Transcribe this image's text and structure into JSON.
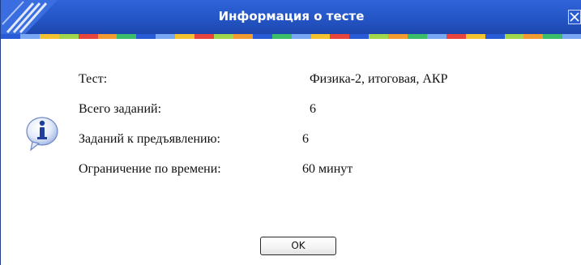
{
  "dialog": {
    "title": "Информация о тесте",
    "colors": {
      "titlebar": "#2557c8",
      "stripe": [
        "#2a5bd6",
        "#7aa7f2",
        "#f2c230",
        "#9fd64a",
        "#e8453c",
        "#f29b30",
        "#3bbd6a",
        "#2a5bd6",
        "#7aa7f2",
        "#f2c230",
        "#e8453c",
        "#9fd64a",
        "#f29b30",
        "#2a5bd6",
        "#3bbd6a",
        "#7aa7f2",
        "#f2c230",
        "#e8453c",
        "#2a5bd6",
        "#9fd64a",
        "#f29b30",
        "#3bbd6a",
        "#7aa7f2",
        "#e8453c",
        "#f2c230",
        "#2a5bd6",
        "#9fd64a",
        "#f29b30",
        "#3bbd6a",
        "#7aa7f2"
      ]
    },
    "icons": {
      "close": "close-icon",
      "info": "info-icon",
      "logo": "logo-icon"
    },
    "fields": [
      {
        "label": "Тест:",
        "value": "Физика-2, итоговая, АКР"
      },
      {
        "label": "Всего заданий:",
        "value": "6"
      },
      {
        "label": "Заданий к предъявлению:",
        "value": "6"
      },
      {
        "label": "Ограничение по времени:",
        "value": "60 минут"
      }
    ],
    "ok_label": "OK"
  }
}
